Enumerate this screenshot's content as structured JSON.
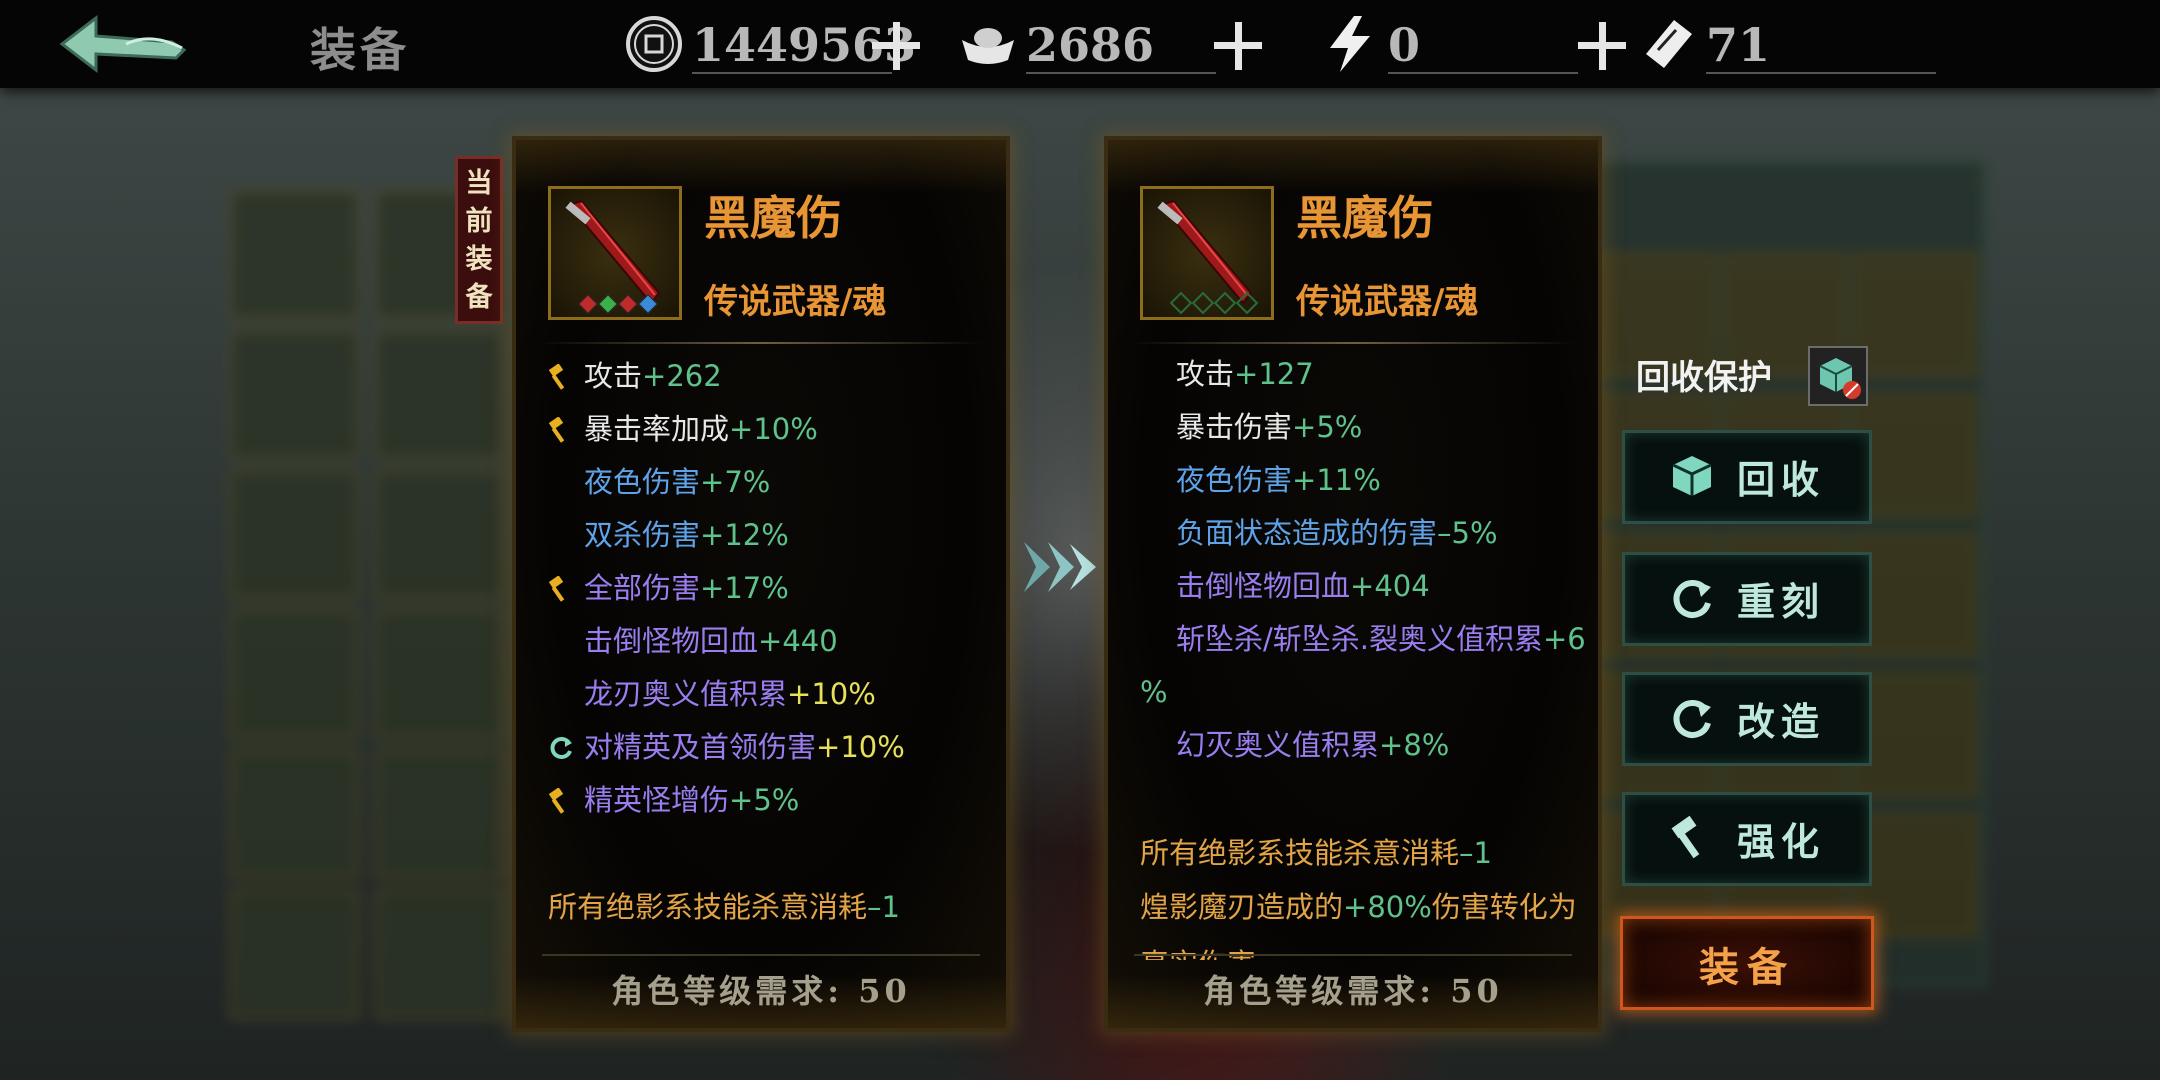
{
  "header": {
    "title": "装备",
    "resources": [
      {
        "name": "coin",
        "value": "1449563",
        "icon": "copper-coin-icon"
      },
      {
        "name": "ingot",
        "value": "2686",
        "icon": "silver-ingot-icon"
      },
      {
        "name": "energy",
        "value": "0",
        "icon": "lightning-icon"
      },
      {
        "name": "ticket",
        "value": "71",
        "icon": "ticket-icon"
      }
    ]
  },
  "current_tag": "当前装备",
  "left_item": {
    "name": "黑魔伤",
    "type": "传说武器/魂",
    "stats": [
      {
        "base": "攻击",
        "bonus": "+262"
      },
      {
        "base": "暴击率加成",
        "bonus": "+10%"
      },
      {
        "base": "夜色伤害",
        "bonus": "+7%"
      },
      {
        "base": "双杀伤害",
        "bonus": "+12%"
      },
      {
        "base": "全部伤害",
        "bonus": "+17%"
      },
      {
        "base": "击倒怪物回血",
        "bonus": "+440"
      },
      {
        "base": "龙刃奥义值积累",
        "bonus": "+10%"
      },
      {
        "base": "对精英及首领伤害",
        "bonus": "+10%"
      },
      {
        "base": "精英怪增伤",
        "bonus": "+5%"
      }
    ],
    "notes": [
      {
        "base": "所有绝影系技能杀意消耗",
        "bonus": "–1"
      }
    ],
    "requirement": "角色等级需求: 50"
  },
  "right_item": {
    "name": "黑魔伤",
    "type": "传说武器/魂",
    "stats": [
      {
        "base": "攻击",
        "bonus": "+127"
      },
      {
        "base": "暴击伤害",
        "bonus": "+5%"
      },
      {
        "base": "夜色伤害",
        "bonus": "+11%"
      },
      {
        "base": "负面状态造成的伤害",
        "bonus": "–5%"
      },
      {
        "base": "击倒怪物回血",
        "bonus": "+404"
      },
      {
        "base": "斩坠杀/斩坠杀.裂奥义值积累",
        "bonus": "+6"
      },
      {
        "base": "",
        "bonus": "%"
      },
      {
        "base": "幻灭奥义值积累",
        "bonus": "+8%"
      }
    ],
    "notes": [
      {
        "base": "所有绝影系技能杀意消耗",
        "bonus": "–1"
      },
      {
        "base": "煌影魔刃造成的",
        "bonus": "+80%",
        "tail": "伤害转化为"
      },
      {
        "base": "真实伤害",
        "bonus": ""
      }
    ],
    "requirement": "角色等级需求: 50"
  },
  "actions": {
    "protect_label": "回收保护",
    "recycle": "回收",
    "reforge": "重刻",
    "modify": "改造",
    "enhance": "强化",
    "equip": "装备"
  },
  "background": {
    "tabs": [
      "",
      "",
      ""
    ]
  }
}
